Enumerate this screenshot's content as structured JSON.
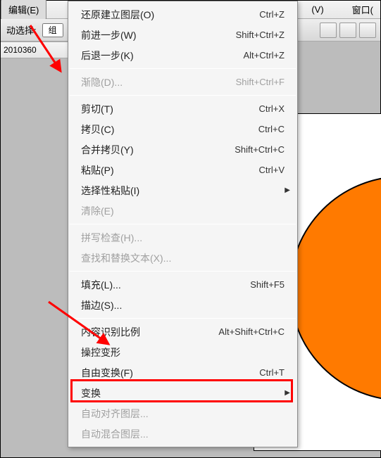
{
  "menubar": {
    "edit": "编辑(E)",
    "view_partial": "(V)",
    "window": "窗口("
  },
  "toolbar": {
    "label": "动选择:",
    "group": "组"
  },
  "titlebar": {
    "text": "2010360"
  },
  "menu": {
    "undo": {
      "label": "还原建立图层(O)",
      "shortcut": "Ctrl+Z"
    },
    "step_forward": {
      "label": "前进一步(W)",
      "shortcut": "Shift+Ctrl+Z"
    },
    "step_back": {
      "label": "后退一步(K)",
      "shortcut": "Alt+Ctrl+Z"
    },
    "fade": {
      "label": "渐隐(D)...",
      "shortcut": "Shift+Ctrl+F"
    },
    "cut": {
      "label": "剪切(T)",
      "shortcut": "Ctrl+X"
    },
    "copy": {
      "label": "拷贝(C)",
      "shortcut": "Ctrl+C"
    },
    "copy_merged": {
      "label": "合并拷贝(Y)",
      "shortcut": "Shift+Ctrl+C"
    },
    "paste": {
      "label": "粘贴(P)",
      "shortcut": "Ctrl+V"
    },
    "paste_special": {
      "label": "选择性粘贴(I)"
    },
    "clear": {
      "label": "清除(E)"
    },
    "spell": {
      "label": "拼写检查(H)..."
    },
    "find": {
      "label": "查找和替换文本(X)..."
    },
    "fill": {
      "label": "填充(L)...",
      "shortcut": "Shift+F5"
    },
    "stroke": {
      "label": "描边(S)..."
    },
    "content_aware": {
      "label": "内容识别比例",
      "shortcut": "Alt+Shift+Ctrl+C"
    },
    "puppet": {
      "label": "操控变形"
    },
    "free_transform": {
      "label": "自由变换(F)",
      "shortcut": "Ctrl+T"
    },
    "transform": {
      "label": "变换"
    },
    "auto_align": {
      "label": "自动对齐图层..."
    },
    "auto_blend": {
      "label": "自动混合图层..."
    }
  }
}
